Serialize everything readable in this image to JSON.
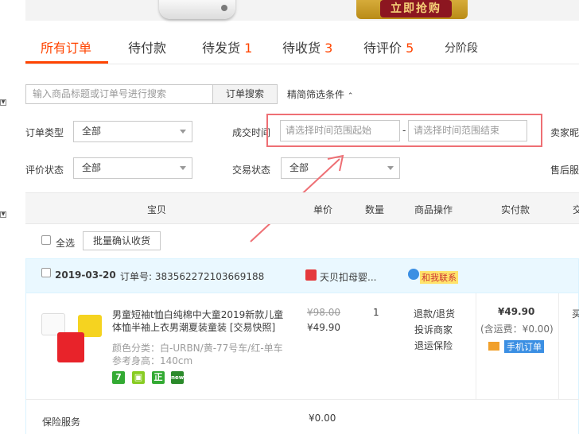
{
  "banner": {
    "buy_now": "立即抢购"
  },
  "tabs": [
    {
      "label": "所有订单",
      "count": ""
    },
    {
      "label": "待付款",
      "count": ""
    },
    {
      "label": "待发货",
      "count": "1"
    },
    {
      "label": "待收货",
      "count": "3"
    },
    {
      "label": "待评价",
      "count": "5"
    },
    {
      "label": "分阶段",
      "count": ""
    }
  ],
  "search": {
    "placeholder": "输入商品标题或订单号进行搜索",
    "button": "订单搜索",
    "filter_toggle": "精简筛选条件"
  },
  "filters": {
    "order_type_label": "订单类型",
    "order_type_value": "全部",
    "deal_time_label": "成交时间",
    "date_start_placeholder": "请选择时间范围起始",
    "date_dash": "-",
    "date_end_placeholder": "请选择时间范围结束",
    "seller_label": "卖家昵",
    "review_status_label": "评价状态",
    "review_status_value": "全部",
    "trade_status_label": "交易状态",
    "trade_status_value": "全部",
    "after_sale_label": "售后服"
  },
  "table_header": {
    "item": "宝贝",
    "unit_price": "单价",
    "quantity": "数量",
    "item_ops": "商品操作",
    "paid": "实付款",
    "trade": "交"
  },
  "select_all": {
    "label": "全选",
    "batch_confirm": "批量确认收货"
  },
  "order": {
    "date": "2019-03-20",
    "order_no_label": "订单号:",
    "order_no": "383562272103669188",
    "shop_name": "天贝扣母婴...",
    "contact": "和我联系",
    "item_title_1": "男童短袖t恤白纯棉中大童2019新款儿童",
    "item_title_2": "体恤半袖上衣男潮夏装童装 [交易快照]",
    "item_spec": "颜色分类：白-URBN/黄-77号车/红-单车",
    "item_height": "参考身高：140cm",
    "original_price": "¥98.00",
    "price": "¥49.90",
    "quantity": "1",
    "refund": "退款/退货",
    "complain": "投诉商家",
    "return_insurance": "退运保险",
    "paid": "¥49.90",
    "shipping_incl": "(含运费：¥0.00)",
    "mobile_order": "手机订单",
    "trade_col_partial": "买",
    "insurance_label": "保险服务",
    "insurance_price": "¥0.00"
  },
  "badges": [
    "7",
    "正",
    "new"
  ],
  "colors": {
    "accent": "#ff4400",
    "highlight_box": "#ee6f74",
    "order_head_bg": "#eaf8ff"
  }
}
